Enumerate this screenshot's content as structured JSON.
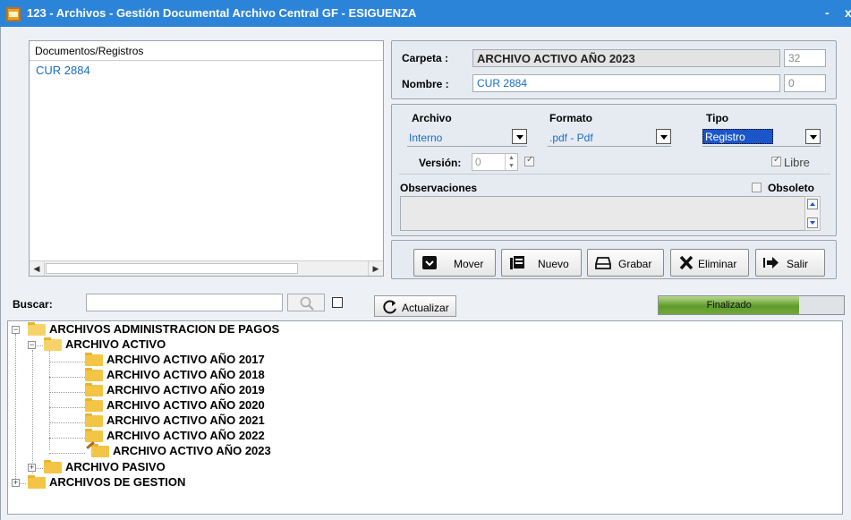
{
  "window": {
    "title": "123 - Archivos - Gestión Documental Archivo Central GF - ESIGUENZA",
    "minimize_glyph": "-",
    "close_glyph": "x"
  },
  "documents": {
    "header": "Documentos/Registros",
    "items": [
      "CUR 2884"
    ]
  },
  "folder_group": {
    "carpeta_label": "Carpeta :",
    "carpeta_value": "ARCHIVO ACTIVO AÑO 2023",
    "carpeta_num": "32",
    "nombre_label": "Nombre :",
    "nombre_value": "CUR 2884",
    "nombre_num": "0"
  },
  "properties": {
    "archivo_label": "Archivo",
    "archivo_value": "Interno",
    "formato_label": "Formato",
    "formato_value": ".pdf - Pdf",
    "tipo_label": "Tipo",
    "tipo_value": "Registro",
    "version_label": "Versión:",
    "version_value": "0",
    "libre_label": "Libre",
    "observaciones_label": "Observaciones",
    "obsoleto_label": "Obsoleto"
  },
  "toolbar": {
    "mover": "Mover",
    "nuevo": "Nuevo",
    "grabar": "Grabar",
    "eliminar": "Eliminar",
    "salir": "Salir"
  },
  "search": {
    "label": "Buscar:",
    "value": "",
    "refresh": "Actualizar"
  },
  "progress": {
    "label": "Finalizado",
    "fraction": 0.76
  },
  "tree": {
    "root": "ARCHIVOS ADMINISTRACION DE PAGOS",
    "activo": "ARCHIVO ACTIVO",
    "years": [
      "ARCHIVO ACTIVO AÑO 2017",
      "ARCHIVO ACTIVO AÑO 2018",
      "ARCHIVO ACTIVO AÑO 2019",
      "ARCHIVO ACTIVO AÑO 2020",
      "ARCHIVO ACTIVO AÑO 2021",
      "ARCHIVO ACTIVO AÑO 2022",
      "ARCHIVO ACTIVO AÑO 2023"
    ],
    "pasivo": "ARCHIVO PASIVO",
    "gestion": "ARCHIVOS DE GESTION"
  },
  "colors": {
    "titlebar": "#2b84d8",
    "link": "#1a6cc4",
    "selected": "#1b56c8",
    "folder": "#f4c545",
    "progress": "#5f9b2b"
  }
}
